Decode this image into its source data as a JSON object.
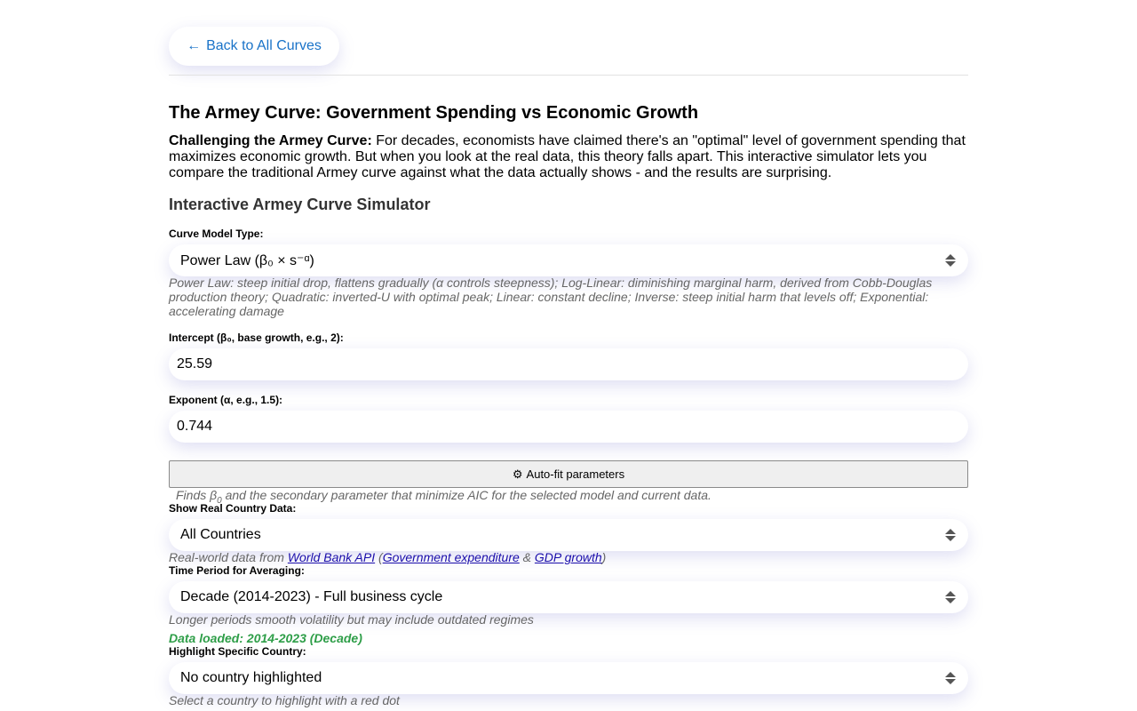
{
  "nav": {
    "back_arrow": "←",
    "back_label": "Back to All Curves"
  },
  "page": {
    "title": "The Armey Curve: Government Spending vs Economic Growth",
    "intro_bold": "Challenging the Armey Curve:",
    "intro_text": " For decades, economists have claimed there's an \"optimal\" level of government spending that maximizes economic growth. But when you look at the real data, this theory falls apart. This interactive simulator lets you compare the traditional Armey curve against what the data actually shows - and the results are surprising.",
    "section_title": "Interactive Armey Curve Simulator"
  },
  "model": {
    "label": "Curve Model Type:",
    "selected": "Power Law (β₀ × s⁻ᵅ)",
    "help": "Power Law: steep initial drop, flattens gradually (α controls steepness); Log-Linear: diminishing marginal harm, derived from Cobb-Douglas production theory; Quadratic: inverted-U with optimal peak; Linear: constant decline; Inverse: steep initial harm that levels off; Exponential: accelerating damage"
  },
  "intercept": {
    "label": "Intercept (β₀, base growth, e.g., 2):",
    "value": "25.59"
  },
  "exponent": {
    "label": "Exponent (α, e.g., 1.5):",
    "value": "0.744"
  },
  "autofit": {
    "icon": "⚙",
    "label": "Auto-fit parameters",
    "help_prefix": "Finds β",
    "help_sub": "0",
    "help_suffix": " and the secondary parameter that minimize AIC for the selected model and current data."
  },
  "country_data": {
    "label": "Show Real Country Data:",
    "selected": "All Countries",
    "help_prefix": "Real-world data from ",
    "link_worldbank": "World Bank API",
    "help_paren_open": " (",
    "link_gov_exp": "Government expenditure",
    "help_amp": " & ",
    "link_gdp": "GDP growth",
    "help_paren_close": ")"
  },
  "period": {
    "label": "Time Period for Averaging:",
    "selected": "Decade (2014-2023) - Full business cycle",
    "help": "Longer periods smooth volatility but may include outdated regimes",
    "status": "Data loaded: 2014-2023 (Decade)",
    "status_color": "#2e9e48"
  },
  "highlight": {
    "label": "Highlight Specific Country:",
    "selected": "No country highlighted",
    "help": "Select a country to highlight with a red dot"
  },
  "colors": {
    "link": "#1a73c8",
    "help_text": "#666666"
  }
}
